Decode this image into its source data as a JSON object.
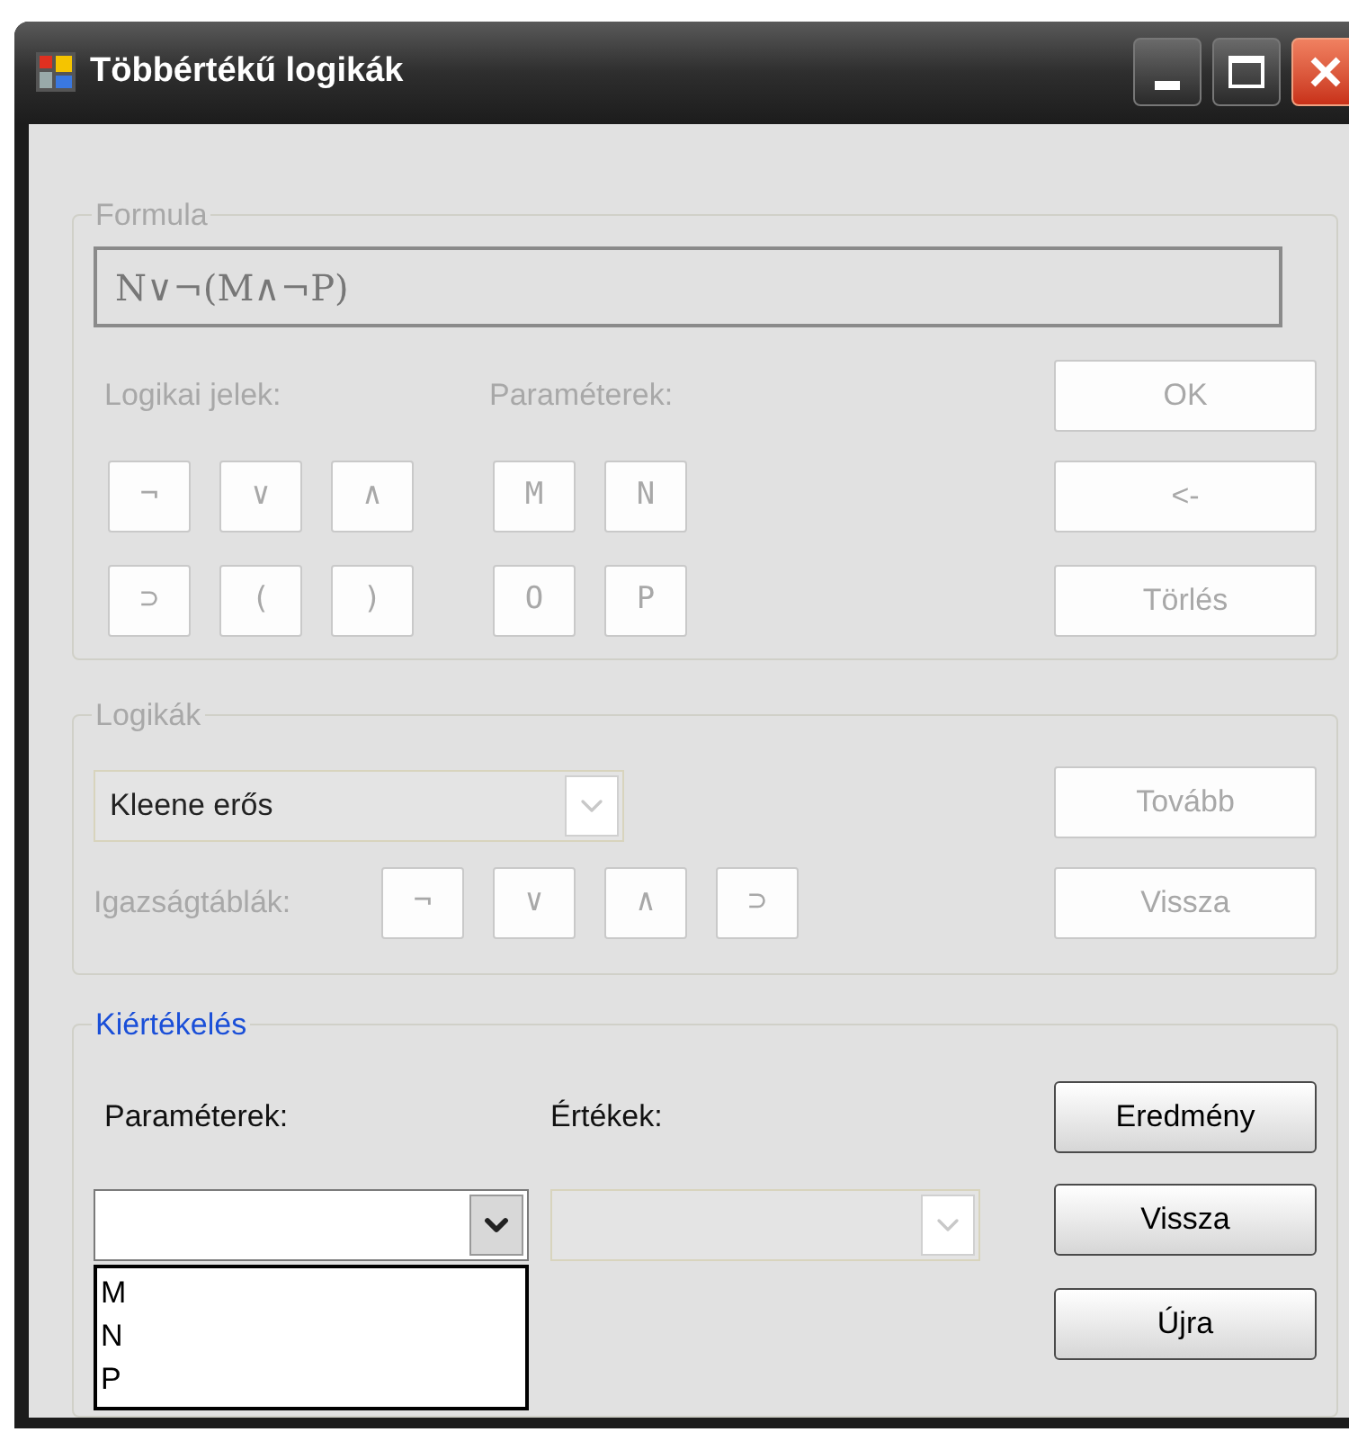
{
  "window": {
    "title": "Többértékű logikák"
  },
  "formula": {
    "legend": "Formula",
    "disabled": true,
    "field": {
      "value": "N∨¬(M∧¬P)"
    },
    "logic_label": "Logikai jelek:",
    "param_label": "Paraméterek:",
    "logic_rows": [
      [
        {
          "label": "¬",
          "disabled": true
        },
        {
          "label": "∨",
          "disabled": true
        },
        {
          "label": "∧",
          "disabled": true
        }
      ],
      [
        {
          "label": "⊃",
          "disabled": true
        },
        {
          "label": "(",
          "disabled": true
        },
        {
          "label": ")",
          "disabled": true
        }
      ]
    ],
    "param_rows": [
      [
        {
          "label": "M",
          "disabled": true
        },
        {
          "label": "N",
          "disabled": true
        }
      ],
      [
        {
          "label": "O",
          "disabled": true
        },
        {
          "label": "P",
          "disabled": true
        }
      ]
    ],
    "actions": [
      {
        "label": "OK",
        "disabled": true
      },
      {
        "label": "<-",
        "disabled": true
      },
      {
        "label": "Törlés",
        "disabled": true
      }
    ]
  },
  "logics": {
    "legend": "Logikák",
    "disabled": true,
    "combo": {
      "value": "Kleene erős",
      "disabled": true
    },
    "table_label": "Igazságtáblák:",
    "table_buttons": [
      {
        "label": "¬",
        "disabled": true
      },
      {
        "label": "∨",
        "disabled": true
      },
      {
        "label": "∧",
        "disabled": true
      },
      {
        "label": "⊃",
        "disabled": true
      }
    ],
    "actions": [
      {
        "label": "Tovább",
        "disabled": true
      },
      {
        "label": "Vissza",
        "disabled": true
      }
    ]
  },
  "evaluation": {
    "legend": "Kiértékelés",
    "disabled": false,
    "params_label": "Paraméterek:",
    "values_label": "Értékek:",
    "params_combo": {
      "disabled": false,
      "expanded": true,
      "options": [
        "M",
        "N",
        "P"
      ]
    },
    "values_combo": {
      "disabled": true
    },
    "actions": [
      {
        "label": "Eredmény",
        "disabled": false
      },
      {
        "label": "Vissza",
        "disabled": false
      },
      {
        "label": "Újra",
        "disabled": false
      }
    ]
  }
}
